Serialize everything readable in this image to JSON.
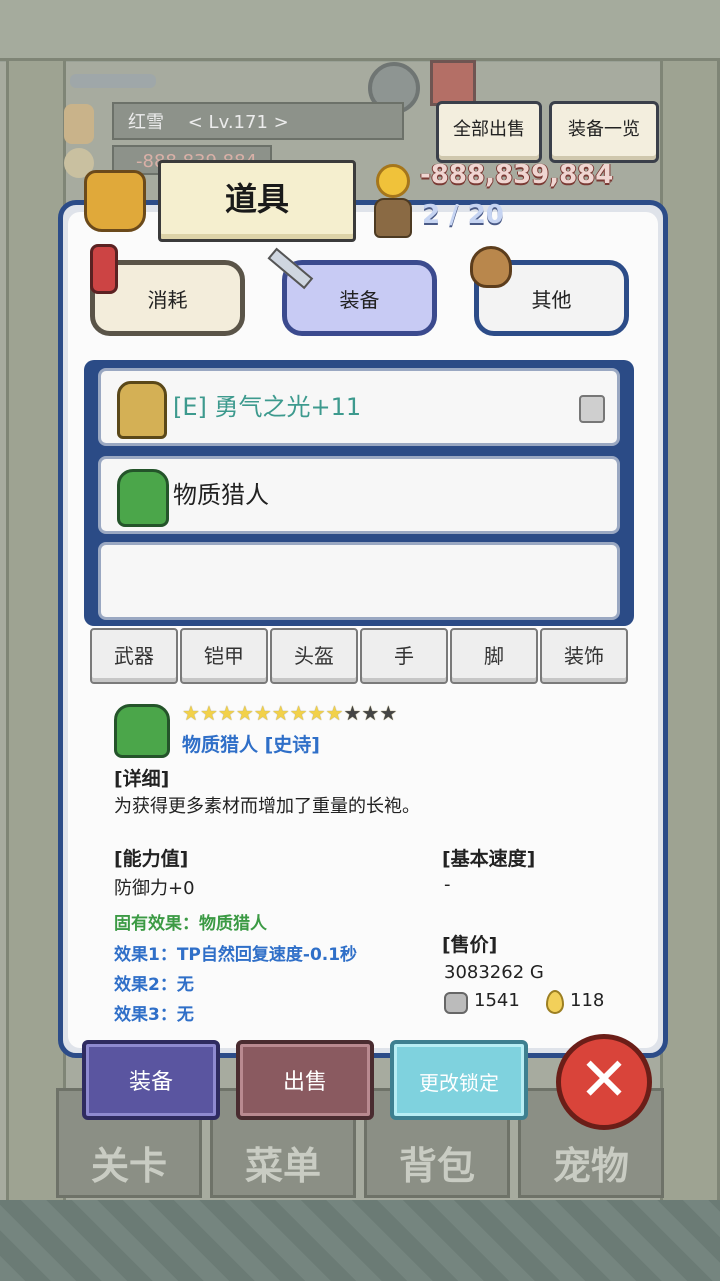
{
  "player": {
    "name": "红雪",
    "level": "< Lv.171 >",
    "gold_obscured": "-888,839,884"
  },
  "header_buttons": {
    "sell_all": "全部出售",
    "equip_list": "装备一览"
  },
  "panel": {
    "title": "道具",
    "gold": "-888,839,884",
    "capacity": "2 / 20",
    "categories": [
      "消耗",
      "装备",
      "其他"
    ],
    "items": [
      {
        "label": "[E] 勇气之光+11",
        "locked": true,
        "icon": "armor-gold-icon"
      },
      {
        "label": "物质猎人",
        "locked": false,
        "icon": "robe-green-icon"
      },
      {
        "label": "",
        "locked": false,
        "icon": ""
      }
    ],
    "slot_tabs": [
      "武器",
      "铠甲",
      "头盔",
      "手",
      "脚",
      "装饰"
    ]
  },
  "detail": {
    "stars_filled": 9,
    "stars_total": 12,
    "name": "物质猎人 [史诗]",
    "detail_header": "[详细]",
    "description": "为获得更多素材而增加了重量的长袍。",
    "ability_header": "[能力值]",
    "defense": "防御力+0",
    "inherent": "固有效果：物质猎人",
    "effect1": "效果1：TP自然回复速度-0.1秒",
    "effect2": "效果2：无",
    "effect3": "效果3：无",
    "speed_header": "[基本速度]",
    "speed_value": "-",
    "price_header": "[售价]",
    "price_gold": "3083262 G",
    "price_stone": "1541",
    "price_drop": "118"
  },
  "actions": {
    "equip": "装备",
    "sell": "出售",
    "change_lock": "更改锁定"
  },
  "bottom_nav": [
    "关卡",
    "菜单",
    "背包",
    "宠物"
  ],
  "colors": {
    "panel_border": "#2c4c88",
    "name_blue": "#2f6fc8",
    "green": "#3b9a44",
    "gold_red": "#f0d6d2"
  }
}
